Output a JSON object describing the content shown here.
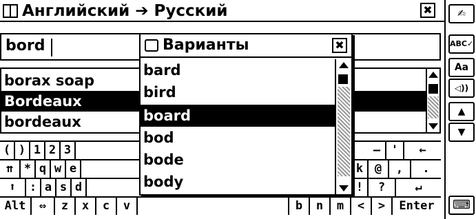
{
  "titlebar": {
    "title": "Английский ➔ Русский",
    "close_label": "✖"
  },
  "toolbar": {
    "items": [
      {
        "name": "handwriting-icon",
        "label": "✍"
      },
      {
        "name": "spellcheck-icon",
        "label": "ABC✓"
      },
      {
        "name": "font-size-button",
        "label": "Aa"
      },
      {
        "name": "speaker-icon",
        "label": "◁))"
      },
      {
        "name": "scroll-up-button",
        "label": "▲"
      },
      {
        "name": "scroll-down-button",
        "label": "▼"
      },
      {
        "name": "keyboard-icon",
        "label": "⌨"
      }
    ]
  },
  "search": {
    "value": "bord"
  },
  "wordlist": {
    "rows": [
      {
        "label": "borax soap",
        "selected": false
      },
      {
        "label": "Bordeaux",
        "selected": true
      },
      {
        "label": "bordeaux",
        "selected": false
      }
    ]
  },
  "popup": {
    "title": "Варианты",
    "close_label": "✖",
    "items": [
      {
        "label": "bard",
        "selected": false
      },
      {
        "label": "bird",
        "selected": false
      },
      {
        "label": "board",
        "selected": true
      },
      {
        "label": "bod",
        "selected": false
      },
      {
        "label": "bode",
        "selected": false
      },
      {
        "label": "body",
        "selected": false
      }
    ]
  },
  "keyboard": {
    "row1": [
      "(",
      ")",
      "1",
      "2",
      "3",
      "",
      "",
      "",
      "",
      "",
      "",
      "–",
      "'",
      "←"
    ],
    "row2": [
      "⇈",
      "*",
      "q",
      "w",
      "e",
      "",
      "",
      "",
      "",
      "",
      "k",
      "@",
      ",",
      "."
    ],
    "row3": [
      "⬆",
      ":",
      "a",
      "s",
      "d",
      "",
      "",
      "",
      "",
      "",
      "!",
      "?",
      "",
      "↵"
    ],
    "row4": [
      "Alt",
      "⇔",
      "z",
      "x",
      "c",
      "v",
      "",
      "b",
      "n",
      "m",
      "<",
      ">",
      "Enter"
    ]
  },
  "colors": {
    "foreground": "#000000",
    "background": "#ffffff",
    "selection": "#000000",
    "hatch": "#999999"
  }
}
